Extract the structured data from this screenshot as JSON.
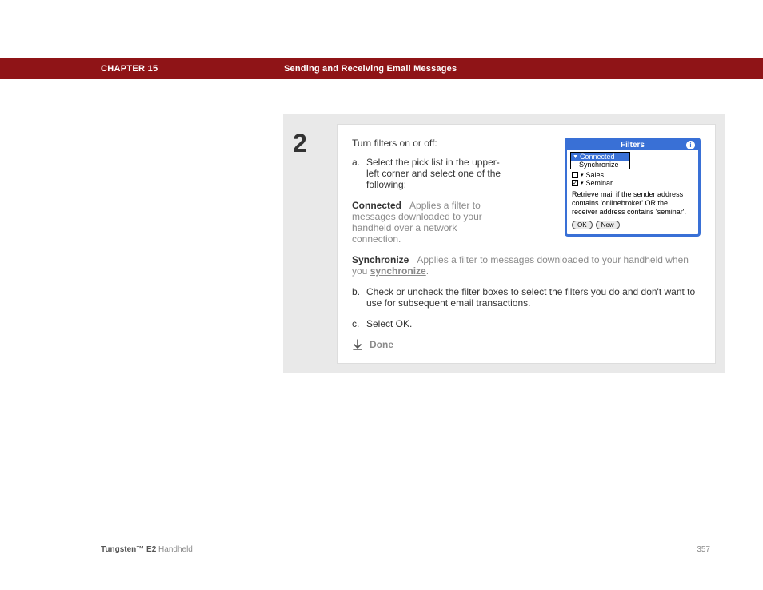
{
  "header": {
    "chapter": "CHAPTER 15",
    "title": "Sending and Receiving Email Messages"
  },
  "step": {
    "number": "2",
    "intro": "Turn filters on or off:",
    "item_a_letter": "a.",
    "item_a_text": "Select the pick list in the upper-left corner and select one of the following:",
    "connected_term": "Connected",
    "connected_desc": "Applies a filter to messages downloaded to your handheld over a network connection.",
    "synchronize_term": "Synchronize",
    "synchronize_desc_pre": "Applies a filter to messages downloaded to your handheld when you ",
    "synchronize_link": "synchronize",
    "synchronize_desc_post": ".",
    "item_b_letter": "b.",
    "item_b_text": "Check or uncheck the filter boxes to select the filters you do and don't want to use for subsequent email transactions.",
    "item_c_letter": "c.",
    "item_c_text": "Select OK.",
    "done": "Done"
  },
  "device": {
    "title": "Filters",
    "info": "i",
    "dropdown_selected": "Connected",
    "dropdown_option": "Synchronize",
    "row_sales": "Sales",
    "row_seminar": "Seminar",
    "message": "Retrieve mail if the sender address contains 'onlinebroker' OR the receiver address contains 'seminar'.",
    "btn_ok": "OK",
    "btn_new": "New"
  },
  "footer": {
    "product_bold": "Tungsten™ E2",
    "product_rest": " Handheld",
    "page": "357"
  }
}
